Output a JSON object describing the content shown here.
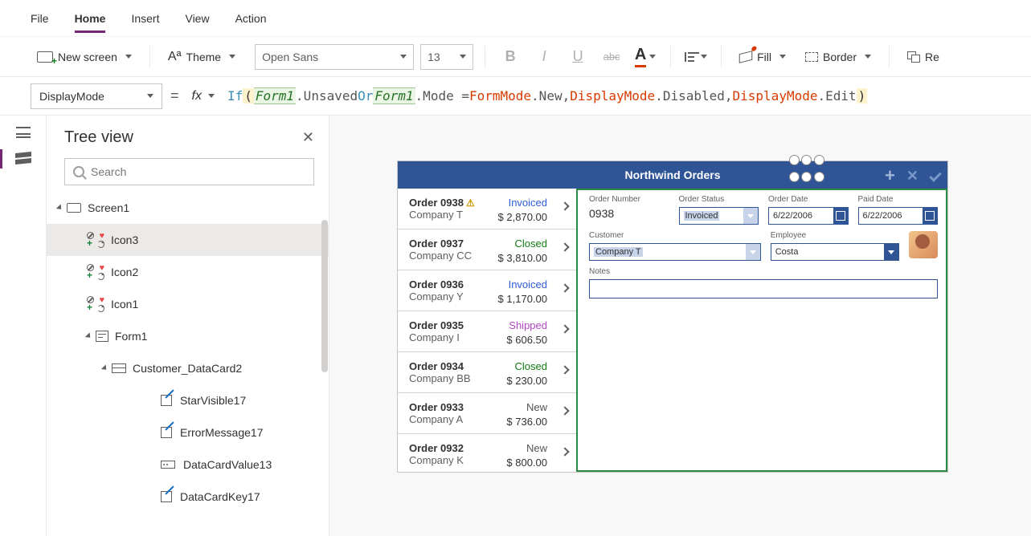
{
  "menu": {
    "file": "File",
    "home": "Home",
    "insert": "Insert",
    "view": "View",
    "action": "Action"
  },
  "cmd": {
    "new_screen": "New screen",
    "theme": "Theme",
    "font": "Open Sans",
    "size": "13",
    "fill": "Fill",
    "border": "Border",
    "reorder": "Re"
  },
  "formula": {
    "property": "DisplayMode",
    "fx": "fx",
    "raw": {
      "if": "If",
      "p1": "( ",
      "f1": "Form1",
      "t1": ".Unsaved ",
      "or": "Or ",
      "f2": "Form1",
      "t2": ".Mode = ",
      "fm": "FormMode",
      "t3": ".New, ",
      "dm1": "DisplayMode",
      "t4": ".Disabled, ",
      "dm2": "DisplayMode",
      "t5": ".Edit ",
      "p2": ")"
    }
  },
  "tree": {
    "title": "Tree view",
    "search_ph": "Search",
    "nodes": {
      "screen": "Screen1",
      "icon3": "Icon3",
      "icon2": "Icon2",
      "icon1": "Icon1",
      "form": "Form1",
      "card": "Customer_DataCard2",
      "starvis": "StarVisible17",
      "errmsg": "ErrorMessage17",
      "dcval": "DataCardValue13",
      "dckey": "DataCardKey17"
    }
  },
  "app": {
    "title": "Northwind Orders",
    "orders": [
      {
        "num": "Order 0938",
        "company": "Company T",
        "status": "Invoiced",
        "amount": "$ 2,870.00",
        "warn": true
      },
      {
        "num": "Order 0937",
        "company": "Company CC",
        "status": "Closed",
        "amount": "$ 3,810.00"
      },
      {
        "num": "Order 0936",
        "company": "Company Y",
        "status": "Invoiced",
        "amount": "$ 1,170.00"
      },
      {
        "num": "Order 0935",
        "company": "Company I",
        "status": "Shipped",
        "amount": "$ 606.50"
      },
      {
        "num": "Order 0934",
        "company": "Company BB",
        "status": "Closed",
        "amount": "$ 230.00"
      },
      {
        "num": "Order 0933",
        "company": "Company A",
        "status": "New",
        "amount": "$ 736.00"
      },
      {
        "num": "Order 0932",
        "company": "Company K",
        "status": "New",
        "amount": "$ 800.00"
      }
    ],
    "detail": {
      "order_number_lbl": "Order Number",
      "order_number": "0938",
      "order_status_lbl": "Order Status",
      "order_status": "Invoiced",
      "order_date_lbl": "Order Date",
      "order_date": "6/22/2006",
      "paid_date_lbl": "Paid Date",
      "paid_date": "6/22/2006",
      "customer_lbl": "Customer",
      "customer": "Company T",
      "employee_lbl": "Employee",
      "employee": "Costa",
      "notes_lbl": "Notes"
    }
  }
}
